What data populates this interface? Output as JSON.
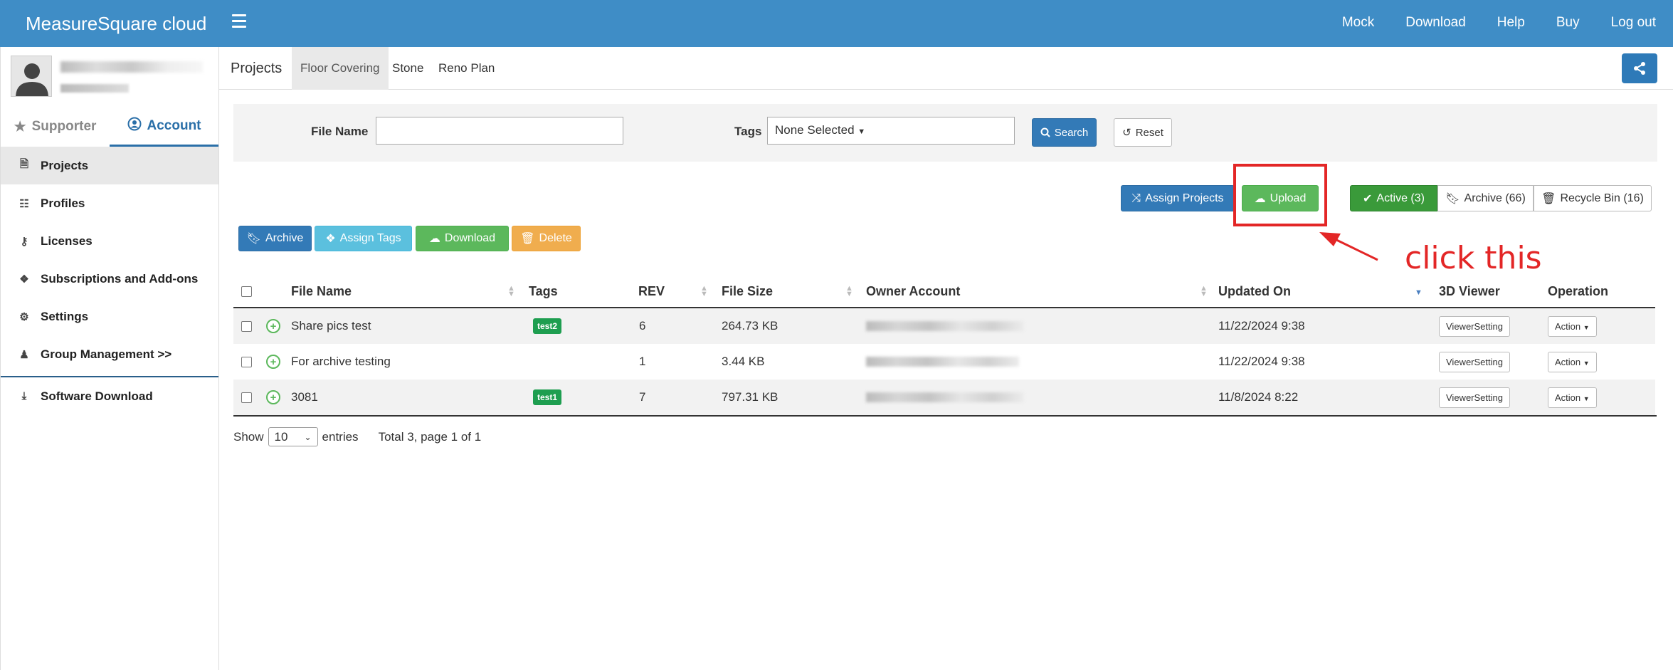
{
  "app": {
    "brand": "MeasureSquare cloud"
  },
  "topnav": [
    "Mock",
    "Download",
    "Help",
    "Buy",
    "Log out"
  ],
  "sidebar": {
    "tabs": [
      {
        "label": "Supporter",
        "icon": "star-icon"
      },
      {
        "label": "Account",
        "icon": "user-circle-icon"
      }
    ],
    "items": [
      {
        "label": "Projects",
        "icon": "file-icon"
      },
      {
        "label": "Profiles",
        "icon": "database-icon"
      },
      {
        "label": "Licenses",
        "icon": "key-icon"
      },
      {
        "label": "Subscriptions and Add-ons",
        "icon": "tags-icon"
      },
      {
        "label": "Settings",
        "icon": "gear-icon"
      },
      {
        "label": "Group Management >>",
        "icon": "users-icon"
      }
    ],
    "software_download": "Software Download"
  },
  "breadcrumb": {
    "projects": "Projects",
    "tabs": [
      "Floor Covering",
      "Stone",
      "Reno Plan"
    ]
  },
  "search": {
    "file_name_label": "File Name",
    "file_name_value": "",
    "tags_label": "Tags",
    "tags_value": "None Selected",
    "search_label": "Search",
    "reset_label": "Reset"
  },
  "actions": {
    "assign_projects": "Assign Projects",
    "upload": "Upload",
    "active": "Active (3)",
    "archive": "Archive (66)",
    "recycle": "Recycle Bin (16)"
  },
  "bulk": {
    "archive": "Archive",
    "assign_tags": "Assign Tags",
    "download": "Download",
    "delete": "Delete"
  },
  "annotation": {
    "text": "click this"
  },
  "table": {
    "headers": [
      "File Name",
      "Tags",
      "REV",
      "File Size",
      "Owner Account",
      "Updated On",
      "3D Viewer",
      "Operation"
    ],
    "rows": [
      {
        "name": "Share pics test",
        "tag": "test2",
        "rev": "6",
        "size": "264.73 KB",
        "updated": "11/22/2024 9:38",
        "viewer": "ViewerSetting",
        "op": "Action"
      },
      {
        "name": "For archive testing",
        "tag": "",
        "rev": "1",
        "size": "3.44 KB",
        "updated": "11/22/2024 9:38",
        "viewer": "ViewerSetting",
        "op": "Action"
      },
      {
        "name": "3081",
        "tag": "test1",
        "rev": "7",
        "size": "797.31 KB",
        "updated": "11/8/2024 8:22",
        "viewer": "ViewerSetting",
        "op": "Action"
      }
    ]
  },
  "pager": {
    "show": "Show",
    "page_size": "10",
    "entries": "entries",
    "total": "Total 3, page 1 of 1"
  }
}
